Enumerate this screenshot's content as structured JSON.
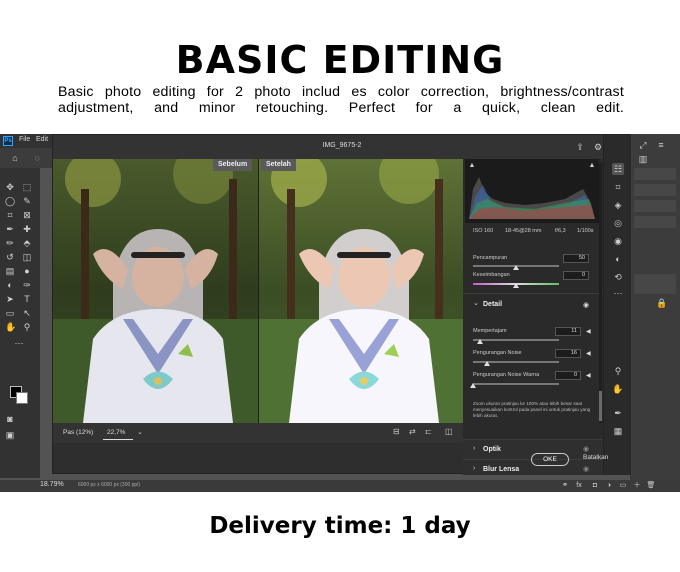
{
  "hero": {
    "title": "BASIC EDITING",
    "description": "Basic photo editing for 2 photo includ es color correction, brightness/contrast adjustment, and minor retouching. Perfect for a quick, clean edit."
  },
  "delivery": "Delivery time: 1 day",
  "photoshop": {
    "logo": "Ps",
    "menu": [
      "File",
      "Edit"
    ],
    "zoom": "18.79%",
    "doc_size": "6000 px x 6000 px (300 ppi)"
  },
  "camera_raw": {
    "filename": "IMG_9675-2",
    "before_label": "Sebelum",
    "after_label": "Setelah",
    "fit_label": "Pas (12%)",
    "zoom_value": "22,7%",
    "exif": {
      "iso": "ISO 160",
      "lens": "18-45@28 mm",
      "aperture": "f/6,3",
      "shutter": "1/100s"
    },
    "sliders_top": [
      {
        "label": "Pencampuran",
        "value": "50",
        "fraction": 0.5
      },
      {
        "label": "Keseimbangan",
        "value": "0",
        "fraction": 0.5
      }
    ],
    "detail": {
      "title": "Detail",
      "sliders": [
        {
          "label": "Mempertajam",
          "value": "11",
          "fraction": 0.08
        },
        {
          "label": "Pengurangan Noise",
          "value": "16",
          "fraction": 0.16
        },
        {
          "label": "Pengurangan Noise Warna",
          "value": "0",
          "fraction": 0.0
        }
      ],
      "note": "Zoom ukuran pratinjau ke 100% atau lebih besar saat menyesuaikan kontrol pada panel ini untuk pratinjau yang lebih akurat."
    },
    "sections": [
      "Optik",
      "Blur Lensa"
    ],
    "ok_label": "OKE",
    "cancel_label": "Batalkan"
  },
  "colors": {
    "ps_background": "#535353",
    "dialog": "#2e2e2e",
    "accent_blue": "#31a8ff"
  }
}
